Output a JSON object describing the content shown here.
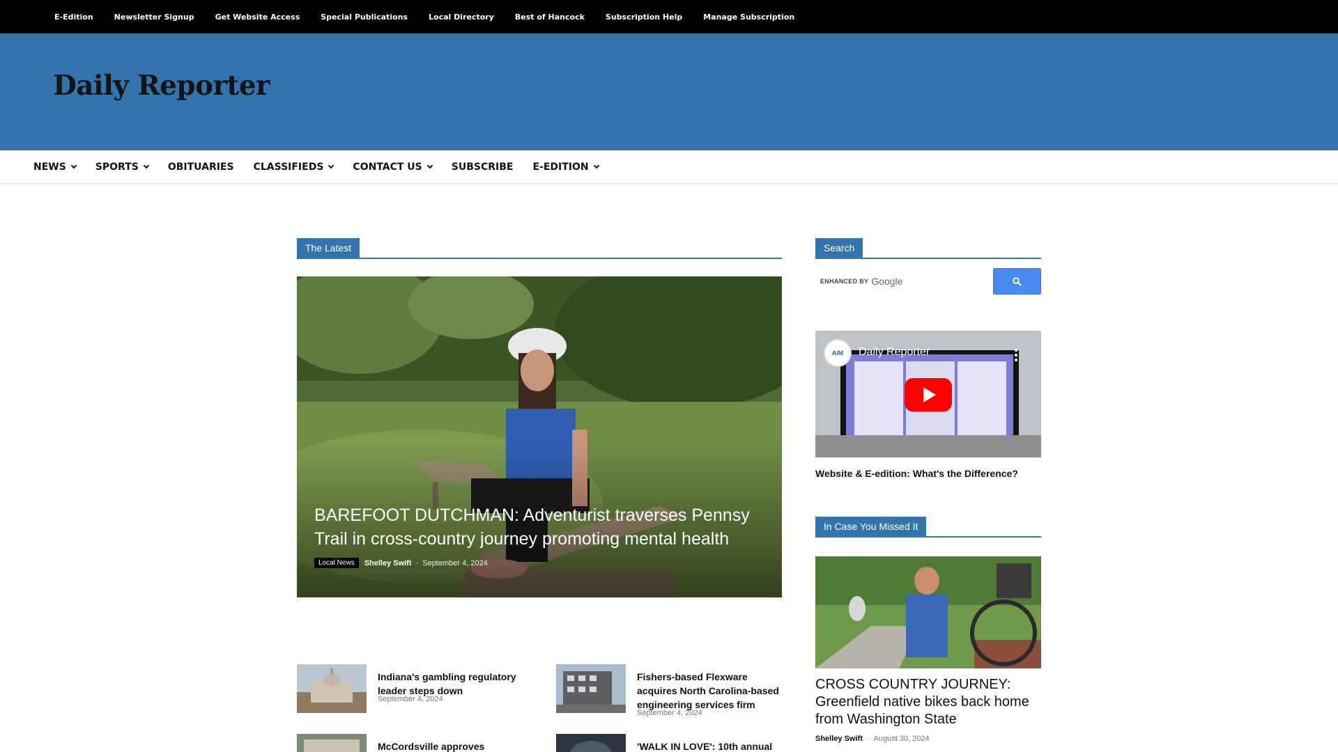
{
  "topbar": {
    "items": [
      "E-Edition",
      "Newsletter Signup",
      "Get Website Access",
      "Special Publications",
      "Local Directory",
      "Best of Hancock",
      "Subscription Help",
      "Manage Subscription"
    ]
  },
  "header": {
    "logo_text": "Daily Reporter"
  },
  "nav": {
    "items": [
      {
        "label": "NEWS",
        "dropdown": true
      },
      {
        "label": "SPORTS",
        "dropdown": true
      },
      {
        "label": "OBITUARIES",
        "dropdown": false
      },
      {
        "label": "CLASSIFIEDS",
        "dropdown": true
      },
      {
        "label": "CONTACT US",
        "dropdown": true
      },
      {
        "label": "SUBSCRIBE",
        "dropdown": false
      },
      {
        "label": "E-EDITION",
        "dropdown": true
      }
    ]
  },
  "latest": {
    "block_title": "The Latest",
    "featured": {
      "title": "BAREFOOT DUTCHMAN: Adventurist traverses Pennsy Trail in cross-country journey promoting mental health",
      "category": "Local News",
      "author": "Shelley Swift",
      "separator": "-",
      "date": "September 4, 2024"
    },
    "articles": [
      {
        "title": "Indiana's gambling regulatory leader steps down",
        "date": "September 4, 2024"
      },
      {
        "title": "Fishers-based Flexware acquires North Carolina-based engineering services firm",
        "date": "September 4, 2024"
      },
      {
        "title": "McCordsville approves",
        "date": ""
      },
      {
        "title": "'WALK IN LOVE': 10th annual",
        "date": ""
      }
    ]
  },
  "sidebar": {
    "search": {
      "block_title": "Search",
      "enhanced_label": "ENHANCED BY",
      "provider": "Google",
      "button_icon": "search-icon"
    },
    "video": {
      "channel_badge": "AIM",
      "title": "Daily Reporter",
      "caption": "Website & E-edition: What's the Difference?"
    },
    "icymi": {
      "block_title": "In Case You Missed It",
      "title": "CROSS COUNTRY JOURNEY: Greenfield native bikes back home from Washington State",
      "author": "Shelley Swift",
      "separator": "-",
      "date": "August 30, 2024"
    }
  },
  "colors": {
    "brand_blue": "#3474ad",
    "topbar_bg": "#000000",
    "search_button": "#4a8af4",
    "youtube_red": "#ff0000"
  }
}
